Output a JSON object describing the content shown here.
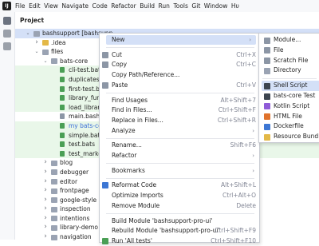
{
  "menubar": {
    "items": [
      "File",
      "Edit",
      "View",
      "Navigate",
      "Code",
      "Refactor",
      "Build",
      "Run",
      "Tools",
      "Git",
      "Window",
      "Hυ"
    ]
  },
  "project": {
    "title": "Project",
    "tree": [
      {
        "label": "bashsupport [bashsupp",
        "indent": 0,
        "arrow": "down",
        "icon": "folder",
        "selected": true,
        "bold_label": true
      },
      {
        "label": ".idea",
        "indent": 1,
        "arrow": "right",
        "icon": "folder-yellow"
      },
      {
        "label": "files",
        "indent": 1,
        "arrow": "down",
        "icon": "folder"
      },
      {
        "label": "bats-core",
        "indent": 2,
        "arrow": "down",
        "icon": "folder"
      },
      {
        "label": "cli-test.bats",
        "indent": 3,
        "icon": "file",
        "green": true
      },
      {
        "label": "duplicates.bats",
        "indent": 3,
        "icon": "file",
        "green": true
      },
      {
        "label": "first-test.bats",
        "indent": 3,
        "icon": "file",
        "green": true
      },
      {
        "label": "library_functio",
        "indent": 3,
        "icon": "file",
        "green": true
      },
      {
        "label": "load_library.bats",
        "indent": 3,
        "icon": "file",
        "green": true
      },
      {
        "label": "main.bash",
        "indent": 3,
        "icon": "file-gray"
      },
      {
        "label": "my bats-core",
        "indent": 3,
        "icon": "file",
        "green": true,
        "blue": true
      },
      {
        "label": "simple.bats",
        "indent": 3,
        "icon": "file",
        "green": true
      },
      {
        "label": "test.bats",
        "indent": 3,
        "icon": "file",
        "green": true
      },
      {
        "label": "test_marker.bats",
        "indent": 3,
        "icon": "file",
        "green": true
      },
      {
        "label": "blog",
        "indent": 2,
        "arrow": "right",
        "icon": "folder"
      },
      {
        "label": "debugger",
        "indent": 2,
        "arrow": "right",
        "icon": "folder"
      },
      {
        "label": "editor",
        "indent": 2,
        "arrow": "right",
        "icon": "folder"
      },
      {
        "label": "frontpage",
        "indent": 2,
        "arrow": "right",
        "icon": "folder"
      },
      {
        "label": "google-style",
        "indent": 2,
        "arrow": "right",
        "icon": "folder"
      },
      {
        "label": "inspection",
        "indent": 2,
        "arrow": "right",
        "icon": "folder"
      },
      {
        "label": "intentions",
        "indent": 2,
        "arrow": "right",
        "icon": "folder"
      },
      {
        "label": "library-demo",
        "indent": 2,
        "arrow": "right",
        "icon": "folder"
      },
      {
        "label": "navigation",
        "indent": 2,
        "arrow": "right",
        "icon": "folder"
      }
    ]
  },
  "context_menu": {
    "items": [
      {
        "label": "New",
        "arrow": true,
        "highlight": true
      },
      {
        "sep": true
      },
      {
        "label": "Cut",
        "shortcut": "Ctrl+X",
        "icon": "cut-icon"
      },
      {
        "label": "Copy",
        "shortcut": "Ctrl+C",
        "icon": "copy-icon"
      },
      {
        "label": "Copy Path/Reference..."
      },
      {
        "label": "Paste",
        "shortcut": "Ctrl+V",
        "icon": "paste-icon"
      },
      {
        "sep": true
      },
      {
        "label": "Find Usages",
        "shortcut": "Alt+Shift+7"
      },
      {
        "label": "Find in Files...",
        "shortcut": "Ctrl+Shift+F"
      },
      {
        "label": "Replace in Files...",
        "shortcut": "Ctrl+Shift+R"
      },
      {
        "label": "Analyze",
        "arrow": true
      },
      {
        "sep": true
      },
      {
        "label": "Rename...",
        "shortcut": "Shift+F6"
      },
      {
        "label": "Refactor",
        "arrow": true
      },
      {
        "sep": true
      },
      {
        "label": "Bookmarks",
        "arrow": true
      },
      {
        "sep": true
      },
      {
        "label": "Reformat Code",
        "shortcut": "Alt+Shift+L",
        "icon": "reformat-icon"
      },
      {
        "label": "Optimize Imports",
        "shortcut": "Ctrl+Alt+O"
      },
      {
        "label": "Remove Module",
        "shortcut": "Delete"
      },
      {
        "sep": true
      },
      {
        "label": "Build Module 'bashsupport-pro-ui'"
      },
      {
        "label": "Rebuild Module 'bashsupport-pro-ui'",
        "shortcut": "Ctrl+Shift+F9"
      },
      {
        "label": "Run 'All tests'",
        "shortcut": "Ctrl+Shift+F10",
        "icon": "run-icon"
      }
    ]
  },
  "submenu": {
    "items": [
      {
        "label": "Module...",
        "icon": "module-icon"
      },
      {
        "label": "File",
        "icon": "file-icon"
      },
      {
        "label": "Scratch File",
        "icon": "scratch-file-icon"
      },
      {
        "label": "Directory",
        "icon": "directory-icon"
      },
      {
        "sep": true
      },
      {
        "label": "Shell Script",
        "icon": "shell-script-icon",
        "highlight": true
      },
      {
        "label": "bats-core Test",
        "icon": "bats-icon"
      },
      {
        "label": "Kotlin Script",
        "icon": "kotlin-icon"
      },
      {
        "label": "HTML File",
        "icon": "html-icon"
      },
      {
        "label": "Dockerfile",
        "icon": "docker-icon"
      },
      {
        "label": "Resource Bundle",
        "icon": "resource-bundle-icon"
      }
    ]
  },
  "colors": {
    "selection": "#d4e0f7",
    "vcs_added_bg": "#e9f7e9",
    "file_green": "#4a9f55",
    "link_blue": "#3b6fd8"
  }
}
